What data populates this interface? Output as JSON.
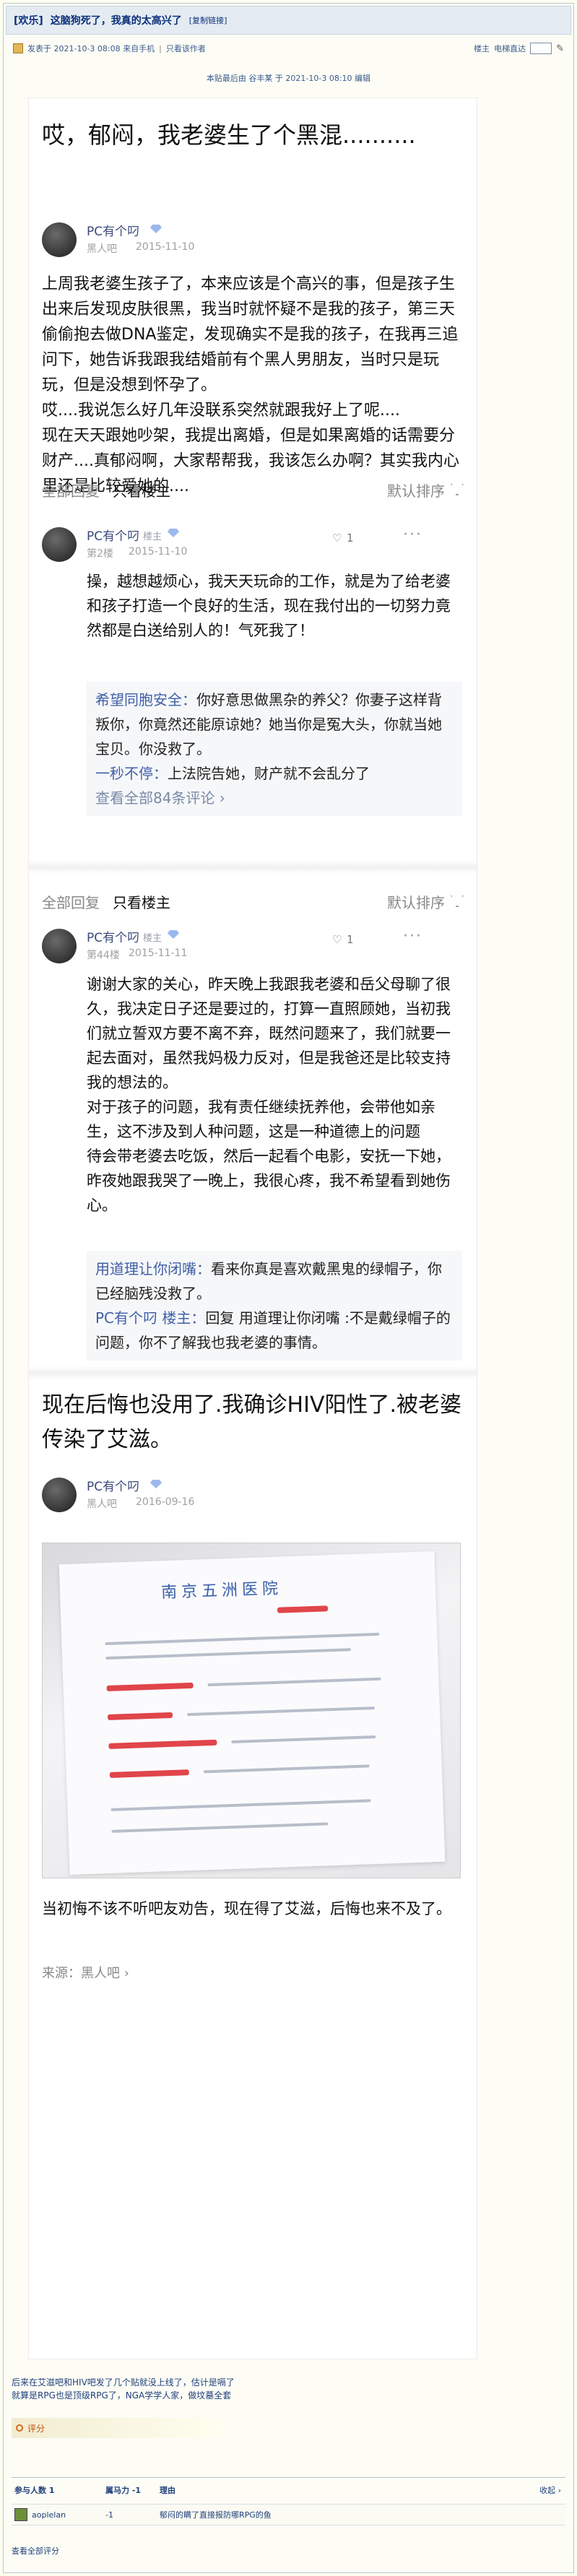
{
  "thread": {
    "category": "[欢乐]",
    "title": "这脑狗死了，我真的太高兴了",
    "copy_link": "[复制链接]",
    "posted": "发表于 2021-10-3 08:08 来自手机",
    "only_author": "只看该作者",
    "floor_label": "楼主",
    "font_label": "电梯直达",
    "edit_note": "本贴最后由 谷丰某 于 2021-10-3 08:10 编辑"
  },
  "post": {
    "title": "哎，郁闷，我老婆生了个黑混..........",
    "author": "PC有个叼",
    "forum": "黑人吧",
    "date": "2015-11-10",
    "body": "上周我老婆生孩子了，本来应该是个高兴的事，但是孩子生出来后发现皮肤很黑，我当时就怀疑不是我的孩子，第三天偷偷抱去做DNA鉴定，发现确实不是我的孩子，在我再三追问下，她告诉我跟我结婚前有个黑人男朋友，当时只是玩玩，但是没想到怀孕了。\n哎....我说怎么好几年没联系突然就跟我好上了呢....\n现在天天跟她吵架，我提出离婚，但是如果离婚的话需要分财产....真郁闷啊，大家帮帮我，我该怎么办啊？其实我内心里还是比较爱她的...."
  },
  "filter": {
    "all": "全部回复",
    "lz_only": "只看楼主",
    "sort": "默认排序"
  },
  "reply1": {
    "author": "PC有个叼",
    "badge": "楼主",
    "floor": "第2楼",
    "date": "2015-11-10",
    "likes": "1",
    "dots": "···",
    "body": "操，越想越烦心，我天天玩命的工作，就是为了给老婆和孩子打造一个良好的生活，现在我付出的一切努力竟然都是白送给别人的！气死我了！",
    "c1_who": "希望同胞安全：",
    "c1_text": "你好意思做黑杂的养父？你妻子这样背叛你，你竟然还能原谅她？她当你是冤大头，你就当她宝贝。你没救了。",
    "c2_who": "一秒不停：",
    "c2_text": "上法院告她，财产就不会乱分了",
    "more": "查看全部84条评论 ›"
  },
  "reply2": {
    "author": "PC有个叼",
    "badge": "楼主",
    "floor": "第44楼",
    "date": "2015-11-11",
    "likes": "1",
    "dots": "···",
    "body": "谢谢大家的关心，昨天晚上我跟我老婆和岳父母聊了很久，我决定日子还是要过的，打算一直照顾她，当初我们就立誓双方要不离不弃，既然问题来了，我们就要一起去面对，虽然我妈极力反对，但是我爸还是比较支持我的想法的。\n对于孩子的问题，我有责任继续抚养他，会带他如亲生，这不涉及到人种问题，这是一种道德上的问题\n待会带老婆去吃饭，然后一起看个电影，安抚一下她，昨夜她跟我哭了一晚上，我很心疼，我不希望看到她伤心。",
    "c1_who": "用道理让你闭嘴：",
    "c1_text": "看来你真是喜欢戴黑鬼的绿帽子，你已经脑残没救了。",
    "c2_who": "PC有个叼 楼主：",
    "c2_text": "回复 用道理让你闭嘴 :不是戴绿帽子的问题，你不了解我也我老婆的事情。"
  },
  "post2": {
    "title": "现在后悔也没用了.我确诊HIV阳性了.被老婆传染了艾滋。",
    "author": "PC有个叼",
    "forum": "黑人吧",
    "date": "2016-09-16",
    "hospital": "南京五洲医院",
    "caption": "当初悔不该不听吧友劝告，现在得了艾滋，后悔也来不及了。",
    "source": "来源：黑人吧 ›"
  },
  "footer": {
    "after_text": "后来在艾滋吧和HIV吧发了几个贴就没上线了，估计是嗝了\n就算是RPG也是顶级RPG了，NGA学学人家，做坟墓全套",
    "rating": "评分",
    "rate_users": "参与人数 1",
    "rate_score": "属马力 -1",
    "rate_reason": "理由",
    "collapse": "收起 ›",
    "user_name": "aoplelan",
    "user_score": "-1",
    "user_reason": "郁闷的瞒了直接报防哪RPG的鱼",
    "view_all": "查看全部评分"
  },
  "colors": {
    "link": "#0b2f7a",
    "blue_name": "#3f5fa6",
    "page_bg": "#fffff0",
    "alert": "#c05010"
  },
  "icons": [
    "user-avatar",
    "gem-icon",
    "funnel-icon",
    "like-icon",
    "more-dots-icon",
    "pen-icon",
    "rating-circle-icon"
  ]
}
